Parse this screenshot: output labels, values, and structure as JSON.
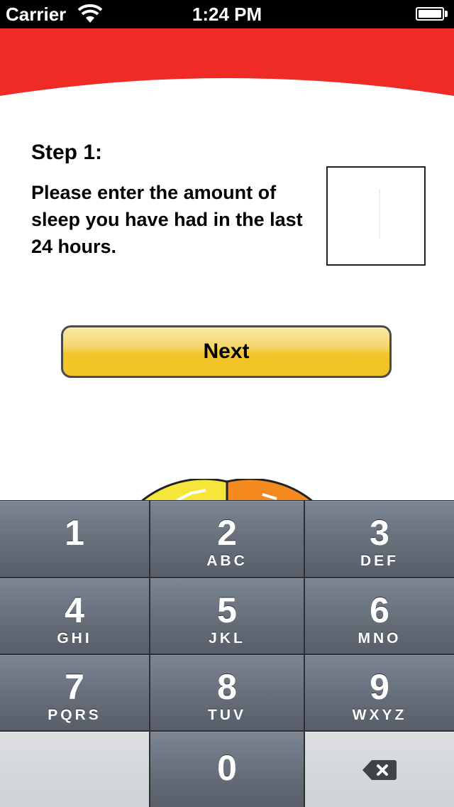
{
  "status_bar": {
    "carrier": "Carrier",
    "time": "1:24 PM"
  },
  "step": {
    "title": "Step 1:",
    "instruction": "Please enter the amount of sleep you have had in the last 24 hours."
  },
  "sleep_input": {
    "value": ""
  },
  "next_button": {
    "label": "Next"
  },
  "banner_color": "#ee2b24",
  "keypad": {
    "keys": [
      {
        "digit": "1",
        "letters": ""
      },
      {
        "digit": "2",
        "letters": "ABC"
      },
      {
        "digit": "3",
        "letters": "DEF"
      },
      {
        "digit": "4",
        "letters": "GHI"
      },
      {
        "digit": "5",
        "letters": "JKL"
      },
      {
        "digit": "6",
        "letters": "MNO"
      },
      {
        "digit": "7",
        "letters": "PQRS"
      },
      {
        "digit": "8",
        "letters": "TUV"
      },
      {
        "digit": "9",
        "letters": "WXYZ"
      },
      {
        "digit": "0",
        "letters": ""
      }
    ],
    "delete_icon": "backspace-icon"
  }
}
